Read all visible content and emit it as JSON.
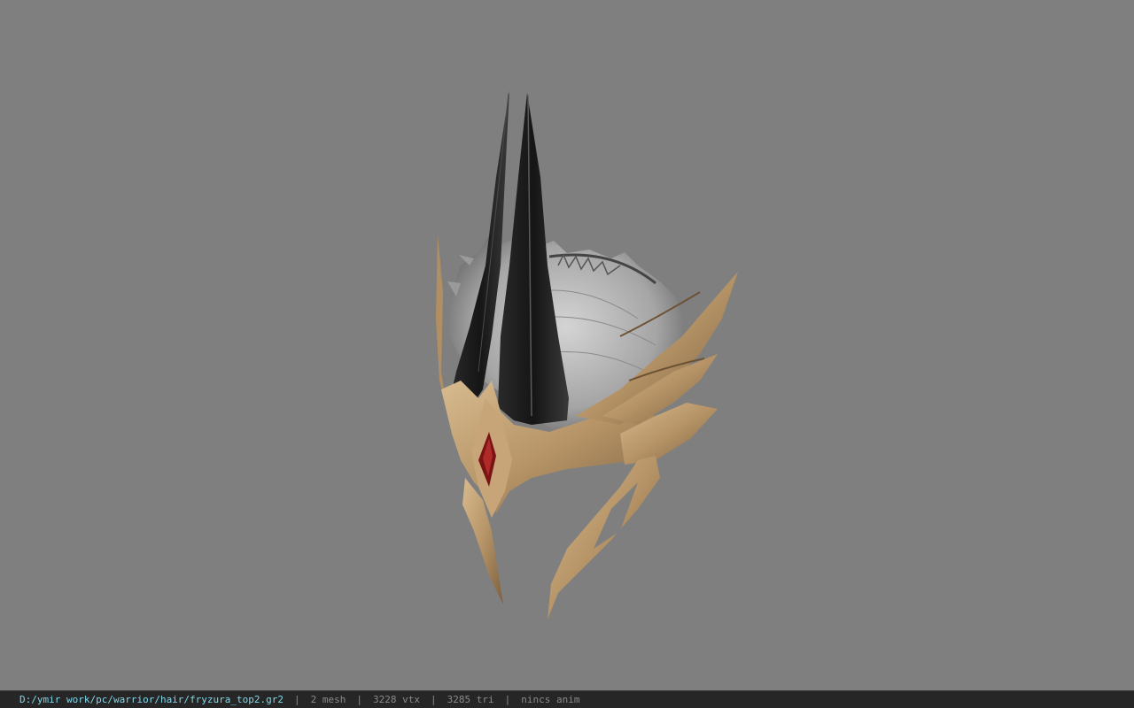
{
  "viewport": {
    "background_color": "#7f7f7f",
    "model_name": "helmet-model"
  },
  "status_bar": {
    "file_path": "D:/ymir work/pc/warrior/hair/fryzura_top2.gr2",
    "separator": "|",
    "mesh_count": "2 mesh",
    "vertex_count": "3228 vtx",
    "triangle_count": "3285 tri",
    "anim_status": "nincs anim",
    "path_color": "#7fd8ea",
    "text_color": "#8a8a8a",
    "background_color": "#262626"
  }
}
